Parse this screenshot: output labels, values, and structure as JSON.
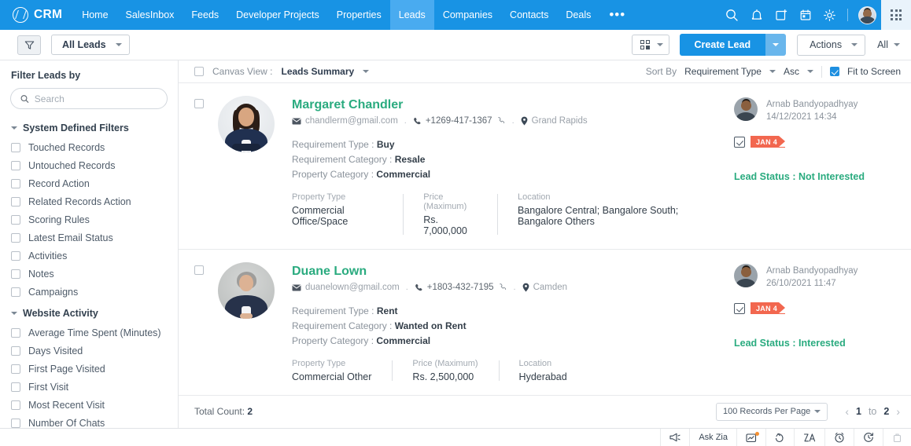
{
  "topnav": {
    "brand": "CRM",
    "items": [
      {
        "label": "Home",
        "active": false
      },
      {
        "label": "SalesInbox",
        "active": false
      },
      {
        "label": "Feeds",
        "active": false
      },
      {
        "label": "Developer Projects",
        "active": false
      },
      {
        "label": "Properties",
        "active": false
      },
      {
        "label": "Leads",
        "active": true
      },
      {
        "label": "Companies",
        "active": false
      },
      {
        "label": "Contacts",
        "active": false
      },
      {
        "label": "Deals",
        "active": false
      }
    ],
    "more_label": "•••",
    "icons": [
      "search-icon",
      "bell-icon",
      "note-add-icon",
      "calendar-icon",
      "gear-icon"
    ],
    "accent": "#1893e4",
    "active_bg": "#49abf0"
  },
  "toolbar": {
    "filter_icon": "funnel-icon",
    "view_label": "All Leads",
    "kanban_icon": "kanban-view-icon",
    "create_label": "Create Lead",
    "actions_label": "Actions",
    "all_label": "All"
  },
  "sidebar": {
    "title": "Filter Leads by",
    "search_placeholder": "Search",
    "search_value": "",
    "groups": [
      {
        "label": "System Defined Filters",
        "items": [
          "Touched Records",
          "Untouched Records",
          "Record Action",
          "Related Records Action",
          "Scoring Rules",
          "Latest Email Status",
          "Activities",
          "Notes",
          "Campaigns"
        ]
      },
      {
        "label": "Website Activity",
        "items": [
          "Average Time Spent (Minutes)",
          "Days Visited",
          "First Page Visited",
          "First Visit",
          "Most Recent Visit",
          "Number Of Chats"
        ]
      }
    ]
  },
  "main_head": {
    "canvas_label": "Canvas View :",
    "canvas_value": "Leads Summary",
    "sort_by_label": "Sort By",
    "sort_field": "Requirement Type",
    "sort_dir": "Asc",
    "fit_label": "Fit to Screen",
    "fit_checked": true
  },
  "cards": [
    {
      "name": "Margaret Chandler",
      "email": "chandlerm@gmail.com",
      "phone": "+1269-417-1367",
      "location": "Grand Rapids",
      "requirement_type_label": "Requirement Type :",
      "requirement_type": "Buy",
      "requirement_category_label": "Requirement Category :",
      "requirement_category": "Resale",
      "property_category_label": "Property Category :",
      "property_category": "Commercial",
      "col_property_type_label": "Property Type",
      "col_property_type": "Commercial Office/Space",
      "col_price_label": "Price (Maximum)",
      "col_price": "Rs. 7,000,000",
      "col_location_label": "Location",
      "col_location": "Bangalore Central; Bangalore South; Bangalore Others",
      "owner": "Arnab Bandyopadhyay",
      "timestamp": "14/12/2021 14:34",
      "task_badge": "JAN 4",
      "lead_status_label": "Lead Status :",
      "lead_status": "Not Interested",
      "photo_gender": "f"
    },
    {
      "name": "Duane Lown",
      "email": "duanelown@gmail.com",
      "phone": "+1803-432-7195",
      "location": "Camden",
      "requirement_type_label": "Requirement Type :",
      "requirement_type": "Rent",
      "requirement_category_label": "Requirement Category :",
      "requirement_category": "Wanted on Rent",
      "property_category_label": "Property Category :",
      "property_category": "Commercial",
      "col_property_type_label": "Property Type",
      "col_property_type": "Commercial Other",
      "col_price_label": "Price (Maximum)",
      "col_price": "Rs. 2,500,000",
      "col_location_label": "Location",
      "col_location": "Hyderabad",
      "owner": "Arnab Bandyopadhyay",
      "timestamp": "26/10/2021 11:47",
      "task_badge": "JAN 4",
      "lead_status_label": "Lead Status :",
      "lead_status": "Interested",
      "photo_gender": "m"
    }
  ],
  "pager": {
    "total_label": "Total Count:",
    "total_count": "2",
    "records_per_page": "100 Records Per Page",
    "range_from": "1",
    "range_to_label": "to",
    "range_to": "2"
  },
  "statusbar": {
    "ask_zia": "Ask Zia",
    "icons": [
      "megaphone-icon",
      "ask-zia",
      "chart-note-icon",
      "undo-arrow-icon",
      "zia-analytics-icon",
      "alarm-clock-icon",
      "history-clock-icon",
      "trash-icon"
    ]
  },
  "colors": {
    "accent": "#1893e4",
    "green": "#2aab7f",
    "ribbon": "#f2674f"
  }
}
